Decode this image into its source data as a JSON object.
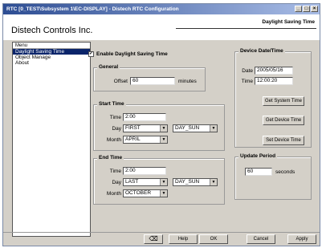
{
  "window": {
    "title": "RTC [0_TEST\\Subsystem 1\\EC-DISPLAY] - Distech RTC Configuration",
    "page_title": "Daylight Saving Time",
    "company": "Distech Controls Inc."
  },
  "menu": {
    "header": "Menu",
    "items": [
      "Daylight Saving Time",
      "Object Manage",
      "About"
    ],
    "selected_index": 0
  },
  "dst": {
    "enable_label": "Enable Daylight Saving Time",
    "enabled": true,
    "general": {
      "title": "General",
      "offset_label": "Offset",
      "offset_value": "60",
      "offset_unit": "minutes"
    },
    "start": {
      "title": "Start Time",
      "time_label": "Time",
      "time_value": "2:00",
      "day_label": "Day",
      "day_week": "FIRST",
      "day_name": "DAY_SUN",
      "month_label": "Month",
      "month_value": "APRIL"
    },
    "end": {
      "title": "End Time",
      "time_label": "Time",
      "time_value": "2:00",
      "day_label": "Day",
      "day_week": "LAST",
      "day_name": "DAY_SUN",
      "month_label": "Month",
      "month_value": "OCTOBER"
    }
  },
  "device": {
    "title": "Device Date/Time",
    "date_label": "Date",
    "date_value": "2005/05/16",
    "time_label": "Time",
    "time_value": "12:00:20",
    "get_system_time": "Get System Time",
    "get_device_time": "Get Device Time",
    "set_device_time": "Set Device Time"
  },
  "update": {
    "title": "Update Period",
    "value": "60",
    "unit": "seconds"
  },
  "footer": {
    "help": "Help",
    "ok": "OK",
    "cancel": "Cancel",
    "apply": "Apply"
  },
  "icons": {
    "dropdown": "▼",
    "check": "✓",
    "minimize": "_",
    "maximize": "□",
    "close": "×",
    "eraser": "⌫"
  }
}
